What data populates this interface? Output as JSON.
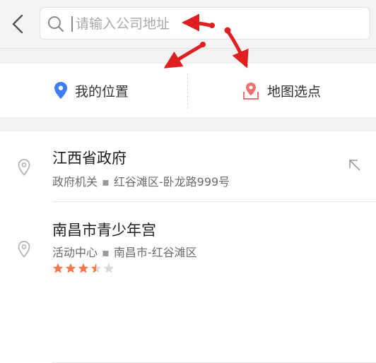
{
  "header": {
    "search_placeholder": "请输入公司地址"
  },
  "options": {
    "my_location": "我的位置",
    "map_pick": "地图选点"
  },
  "results": [
    {
      "title": "江西省政府",
      "category": "政府机关",
      "address": "红谷滩区-卧龙路999号"
    },
    {
      "title": "南昌市青少年宫",
      "category": "活动中心",
      "address": "南昌市-红谷滩区",
      "rating": 3.5
    }
  ],
  "colors": {
    "location_icon": "#3d7ff3",
    "map_icon": "#f07070",
    "star_filled": "#f2794b",
    "star_empty": "#d9d9d9",
    "annotation_arrow": "#e02020"
  }
}
